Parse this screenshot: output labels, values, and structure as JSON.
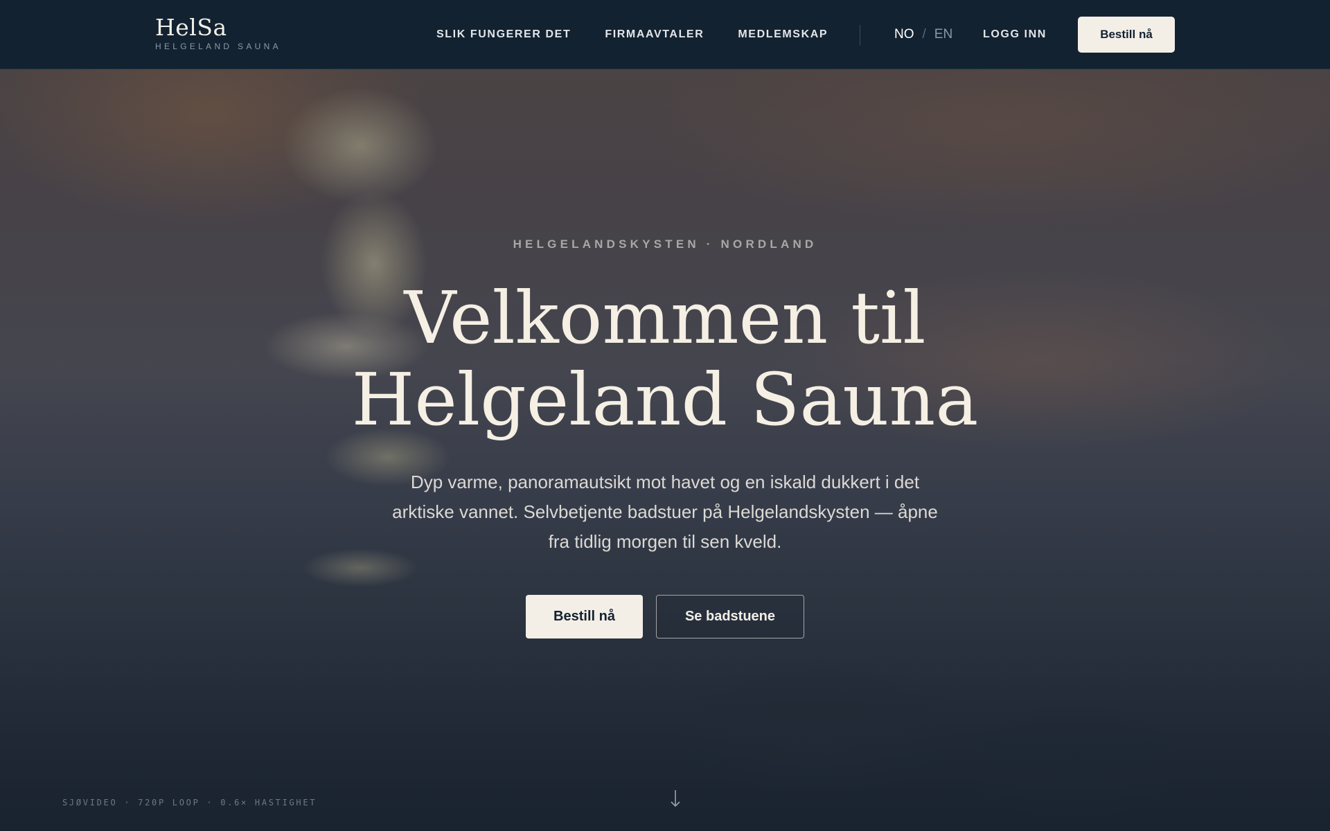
{
  "brand": {
    "name": "HelSa",
    "tagline": "HELGELAND SAUNA"
  },
  "nav": {
    "links": [
      "SLIK FUNGERER DET",
      "FIRMAAVTALER",
      "MEDLEMSKAP"
    ],
    "lang_active": "NO",
    "lang_sep": "/",
    "lang_other": "EN",
    "login": "LOGG INN",
    "cta": "Bestill nå"
  },
  "hero": {
    "eyebrow": "HELGELANDSKYSTEN · NORDLAND",
    "title_line1": "Velkommen til",
    "title_line2": "Helgeland Sauna",
    "description": "Dyp varme, panoramautsikt mot havet og en iskald dukkert i det arktiske vannet. Selvbetjente badstuer på Helgelandskysten — åpne fra tidlig morgen til sen kveld.",
    "primary_button": "Bestill nå",
    "secondary_button": "Se badstuene",
    "video_caption": "SJØVIDEO · 720P LOOP · 0.6× HASTIGHET"
  },
  "icons": {
    "scroll": "arrow-down-icon"
  },
  "colors": {
    "header_bg": "#132231",
    "button_bg": "#f3efe7",
    "text_light": "#f3efe7"
  }
}
